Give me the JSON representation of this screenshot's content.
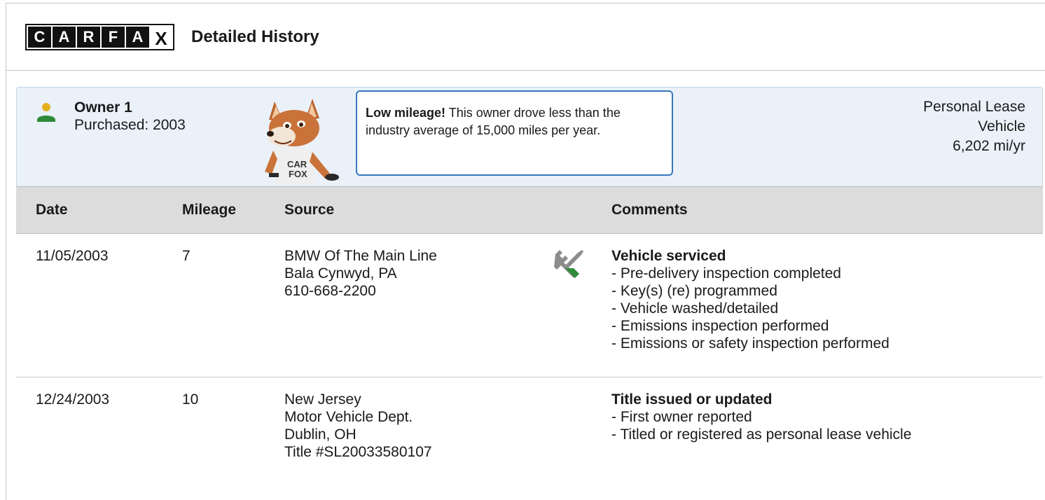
{
  "header": {
    "logo_letters": [
      "C",
      "A",
      "R",
      "F",
      "A",
      "X"
    ],
    "title": "Detailed History"
  },
  "owner": {
    "title": "Owner 1",
    "purchased": "Purchased: 2003",
    "callout_bold": "Low mileage!",
    "callout_text": " This owner drove less than the industry average of 15,000 miles per year.",
    "type_line1": "Personal Lease",
    "type_line2": "Vehicle",
    "mileage_rate": "6,202 mi/yr",
    "icon": "person-icon",
    "mascot_shirt": "CAR FOX"
  },
  "table": {
    "columns": [
      "Date",
      "Mileage",
      "Source",
      "Comments"
    ],
    "rows": [
      {
        "date": "11/05/2003",
        "mileage": "7",
        "source": [
          "BMW Of The Main Line",
          "Bala Cynwyd, PA",
          "610-668-2200"
        ],
        "icon": "service-tools-icon",
        "comment_title": "Vehicle serviced",
        "comment_items": [
          "Pre-delivery inspection completed",
          "Key(s) (re) programmed",
          "Vehicle washed/detailed",
          "Emissions inspection performed",
          "Emissions or safety inspection performed"
        ]
      },
      {
        "date": "12/24/2003",
        "mileage": "10",
        "source": [
          "New Jersey",
          "Motor Vehicle Dept.",
          "Dublin, OH",
          "Title #SL20033580107"
        ],
        "comment_title": "Title issued or updated",
        "comment_items": [
          "First owner reported",
          "Titled or registered as personal lease vehicle"
        ]
      }
    ]
  },
  "colors": {
    "owner_panel_bg": "#eaf1f9",
    "callout_border": "#3777bc",
    "table_header_bg": "#dcdcdc",
    "person_head": "#e3b11f",
    "person_body": "#2e8b3a",
    "wrench_gray": "#8c8c8c",
    "screwdriver_green": "#2e8b3a"
  }
}
